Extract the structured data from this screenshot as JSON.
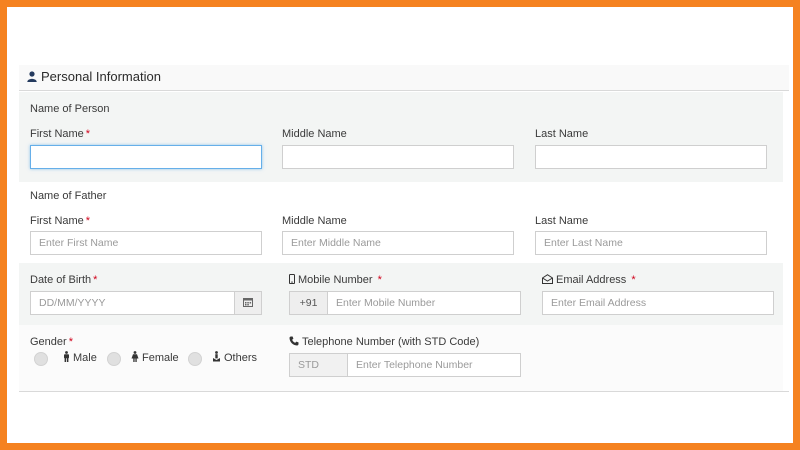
{
  "section_title": "Personal Information",
  "person": {
    "heading": "Name of Person",
    "first_label": "First Name",
    "middle_label": "Middle Name",
    "last_label": "Last Name",
    "first_value": "",
    "middle_value": "",
    "last_value": ""
  },
  "father": {
    "heading": "Name of Father",
    "first_label": "First Name",
    "middle_label": "Middle Name",
    "last_label": "Last Name",
    "first_placeholder": "Enter First Name",
    "middle_placeholder": "Enter Middle Name",
    "last_placeholder": "Enter Last Name"
  },
  "dob": {
    "label": "Date of Birth",
    "placeholder": "DD/MM/YYYY",
    "icon": "calendar-icon"
  },
  "mobile": {
    "label": "Mobile Number",
    "prefix": "+91",
    "placeholder": "Enter Mobile Number",
    "icon": "mobile-phone-icon"
  },
  "email": {
    "label": "Email Address",
    "placeholder": "Enter Email Address",
    "icon": "envelope-icon"
  },
  "gender": {
    "label": "Gender",
    "options": [
      {
        "label": "Male",
        "icon": "male-icon"
      },
      {
        "label": "Female",
        "icon": "female-icon"
      },
      {
        "label": "Others",
        "icon": "others-icon"
      }
    ]
  },
  "telephone": {
    "label": "Telephone Number (with STD Code)",
    "std_placeholder": "STD",
    "placeholder": "Enter Telephone Number",
    "icon": "phone-icon"
  },
  "required_mark": "*",
  "colors": {
    "frame": "#f58220",
    "required": "#d0021b",
    "focus": "#66afe9"
  }
}
